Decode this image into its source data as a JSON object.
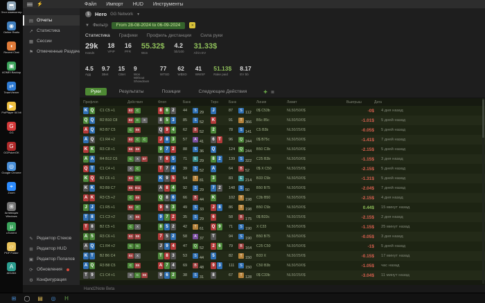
{
  "menubar": {
    "items": [
      "Файл",
      "Импорт",
      "HUD",
      "Инструменты"
    ]
  },
  "sidebar": {
    "top": [
      {
        "label": "Отчеты",
        "glyph": "▤",
        "selected": true
      },
      {
        "label": "Статистика",
        "glyph": "↗"
      },
      {
        "label": "Сессии",
        "glyph": "▦"
      },
      {
        "label": "Отмеченные Раздачи",
        "glyph": "⚑"
      }
    ],
    "bottom": [
      {
        "label": "Редактор Стеков",
        "glyph": "✎"
      },
      {
        "label": "Редактор HUD",
        "glyph": "⊞"
      },
      {
        "label": "Редактор Попапов",
        "glyph": "▣"
      },
      {
        "label": "Обновления",
        "glyph": "⟳",
        "badge": true
      },
      {
        "label": "Конфигурация",
        "glyph": "⚙"
      }
    ]
  },
  "header": {
    "player": "Hero",
    "network": "GG Network",
    "filter_label": "Фильтр",
    "date_range": "From 28-08-2024 to 06-09-2024"
  },
  "view_tabs": [
    {
      "label": "Статистика",
      "active": true
    },
    {
      "label": "Графики"
    },
    {
      "label": "Профиль дистанции"
    },
    {
      "label": "Сила руки"
    }
  ],
  "stats_primary": [
    {
      "value": "29k",
      "label": "Hands",
      "cls": "big"
    },
    {
      "value": "18",
      "label": "VPIP"
    },
    {
      "value": "16",
      "label": "PFR"
    },
    {
      "value": "55.32$",
      "label": "Won",
      "cls": "big green"
    },
    {
      "value": "4.2",
      "label": "bb/100"
    },
    {
      "value": "31.33$",
      "label": "All-in EV",
      "cls": "big green"
    }
  ],
  "stats_secondary": [
    {
      "value": "4.5",
      "label": "Agg"
    },
    {
      "value": "9.7",
      "label": "3Bet"
    },
    {
      "value": "15",
      "label": "CBet"
    },
    {
      "value": "9",
      "label": "Won Without Showdown"
    },
    {
      "value": "77",
      "label": "WTSD"
    },
    {
      "value": "62",
      "label": "W$SD"
    },
    {
      "value": "41",
      "label": "WWSF"
    },
    {
      "value": "51.13$",
      "label": "Rake paid",
      "cls": "green"
    },
    {
      "value": "8.17",
      "label": "EV bb"
    }
  ],
  "table_tabs": [
    {
      "label": "Руки",
      "active": true
    },
    {
      "label": "Результаты"
    },
    {
      "label": "Позиции"
    },
    {
      "label": "Следующие Действия"
    }
  ],
  "hands": {
    "headers": [
      "Префлоп",
      "",
      "Действия",
      "Флоп",
      "Банк",
      "",
      "Терн",
      "Банк",
      "",
      "Линия",
      "Лимит",
      "",
      "Выигрыш",
      "Дата",
      ""
    ],
    "rows": [
      {
        "hole": [
          "Kd",
          "Qc"
        ],
        "pre": "C1 C5 +1",
        "acts": [
          "b:B3",
          "c:C"
        ],
        "flop": [
          "8h",
          "6c",
          "2s"
        ],
        "pot": "44",
        "s1": "S:29",
        "b2": [
          "Jd"
        ],
        "pot2": "87",
        "s2": "S:112",
        "line": "0$ C53b",
        "nl": "NL50/50/0$",
        "profit": "-0$",
        "pc": "neg",
        "date": "4 дня назад"
      },
      {
        "hole": [
          "Qc",
          "Qd"
        ],
        "pre": "R2 B10 C8",
        "acts": [
          "b:B2",
          "c:C",
          "x:X"
        ],
        "flop": [
          "8s",
          "5c",
          "3d"
        ],
        "pot": "85",
        "s1": "S:52",
        "b2": [
          "Kh"
        ],
        "pot2": "91",
        "s2": "T:366",
        "line": "B5c 85c",
        "nl": "NL50/50/0$",
        "profit": "-1.01$",
        "pc": "neg",
        "date": "5 дней назад"
      },
      {
        "hole": [
          "Ah",
          "Qd"
        ],
        "pre": "R3 B7 C5",
        "acts": [
          "c:C",
          "b:B5"
        ],
        "flop": [
          "Qs",
          "9h",
          "4c"
        ],
        "pot": "62",
        "s1": "B:52",
        "b2": [
          "2c"
        ],
        "pot2": "78",
        "s2": "S:141",
        "line": "C5 B3b",
        "nl": "NL50/25/0$",
        "profit": "-0.05$",
        "pc": "neg",
        "date": "5 дней назад"
      },
      {
        "hole": [
          "Ad",
          "Qs"
        ],
        "pre": "C1 R4 +2",
        "acts": [
          "b:B3",
          "c:C",
          "c:C"
        ],
        "flop": [
          "Jh",
          "8d",
          "3c"
        ],
        "pot": "57",
        "s1": "A:41",
        "b2": [
          "6s",
          "Th"
        ],
        "pot2": "96",
        "s2": "Q:244",
        "line": "0$ B75c",
        "nl": "NL50/50/0$",
        "profit": "-1.41$",
        "pc": "neg",
        "date": "7 дней назад"
      },
      {
        "hole": [
          "Kh",
          "Kc"
        ],
        "pre": "R3 C8 +1",
        "acts": [
          "b:B5",
          "b:B9"
        ],
        "flop": [
          "9c",
          "7d",
          "2h"
        ],
        "pot": "88",
        "s1": "S:36",
        "b2": [
          "Qd"
        ],
        "pot2": "124",
        "s2": "Q:244",
        "line": "B50 C3b",
        "nl": "NL50/50/0$",
        "profit": "-2.15$",
        "pc": "neg",
        "date": "5 дней назад"
      },
      {
        "hole": [
          "Ac",
          "Ad"
        ],
        "pre": "R4 B12 C6",
        "acts": [
          "c:C",
          "x:X",
          "b:B7"
        ],
        "flop": [
          "Ts",
          "6h",
          "5d"
        ],
        "pot": "71",
        "s1": "E:29",
        "b2": [
          "8c",
          "2d"
        ],
        "pot2": "139",
        "s2": "S:322",
        "line": "C25 B3b",
        "nl": "NL50/50/0$",
        "profit": "-1.15$",
        "pc": "neg",
        "date": "3 дня назад"
      },
      {
        "hole": [
          "Qh",
          "Td"
        ],
        "pre": "C1 C4 +1",
        "acts": [
          "x:X",
          "c:C"
        ],
        "flop": [
          "Th",
          "7s",
          "4d"
        ],
        "pot": "39",
        "s1": "S:52",
        "b2": [
          "Ad"
        ],
        "pot2": "64",
        "s2": "B:52",
        "line": "0$ X C50",
        "nl": "NL50/25/0$",
        "profit": "-2.15$",
        "pc": "neg",
        "date": "5 дней назад"
      },
      {
        "hole": [
          "Kc",
          "Qh"
        ],
        "pre": "B2 C6 +1",
        "acts": [
          "b:B3",
          "c:C"
        ],
        "flop": [
          "Kd",
          "9s",
          "5h"
        ],
        "pot": "54",
        "s1": "T:81",
        "b2": [
          "3c"
        ],
        "pot2": "83",
        "s2": "E:214",
        "line": "B33 C5b",
        "nl": "NL50/50/0$",
        "profit": "-1.31$",
        "pc": "neg",
        "date": "5 дней назад"
      },
      {
        "hole": [
          "Ks",
          "Kd"
        ],
        "pre": "R3 B9 C7",
        "acts": [
          "b:B5",
          "b:B11"
        ],
        "flop": [
          "As",
          "8h",
          "4c"
        ],
        "pot": "92",
        "s1": "S:29",
        "b2": [
          "7d",
          "2s"
        ],
        "pot2": "148",
        "s2": "S:50",
        "line": "B50 B75",
        "nl": "NL50/50/0$",
        "profit": "-2.04$",
        "pc": "neg",
        "date": "7 дней назад"
      },
      {
        "hole": [
          "Ah",
          "Kh"
        ],
        "pre": "R3 C5 +2",
        "acts": [
          "c:C",
          "b:B6"
        ],
        "flop": [
          "Qc",
          "8s",
          "6d"
        ],
        "pot": "66",
        "s1": "B:44",
        "b2": [
          "Kc"
        ],
        "pot2": "102",
        "s2": "T:198",
        "line": "C3b B50",
        "nl": "NL50/50/0$",
        "profit": "-2.15$",
        "pc": "neg",
        "date": "4 дня назад"
      },
      {
        "hole": [
          "Jc",
          "Jd"
        ],
        "pre": "C1 R5 +1",
        "acts": [
          "b:B4",
          "c:C"
        ],
        "flop": [
          "9h",
          "6s",
          "3c"
        ],
        "pot": "49",
        "s1": "S:33",
        "b2": [
          "Jh",
          "8d"
        ],
        "pot2": "86",
        "s2": "T:198",
        "line": "B50 C5b",
        "nl": "NL50/50/0$",
        "profit": "0.44$",
        "pc": "pos",
        "date": "15 минут назад"
      },
      {
        "hole": [
          "Td",
          "8d"
        ],
        "pre": "C1 C3 +2",
        "acts": [
          "x:X",
          "b:B5"
        ],
        "flop": [
          "9d",
          "7c",
          "2h"
        ],
        "pot": "35",
        "s1": "S:29",
        "b2": [
          "6h"
        ],
        "pot2": "58",
        "s2": "B:175",
        "line": "0$ B33c",
        "nl": "NL50/25/0$",
        "profit": "-2.15$",
        "pc": "neg",
        "date": "2 дня назад"
      },
      {
        "hole": [
          "Th",
          "8s"
        ],
        "pre": "B2 C5 +1",
        "acts": [
          "c:C",
          "x:X"
        ],
        "flop": [
          "8c",
          "5d",
          "2s"
        ],
        "pot": "42",
        "s1": "T:61",
        "b2": [
          "Qh",
          "9c"
        ],
        "pot2": "71",
        "s2": "S:190",
        "line": "X C33",
        "nl": "NL50/50/0$",
        "profit": "-1.15$",
        "pc": "neg",
        "date": "25 минут назад"
      },
      {
        "hole": [
          "Ac",
          "5c"
        ],
        "pre": "R3 C6 +1",
        "acts": [
          "b:B3",
          "b:B8"
        ],
        "flop": [
          "7h",
          "5s",
          "2d"
        ],
        "pot": "58",
        "s1": "A:37",
        "b2": [
          "Ts"
        ],
        "pot2": "94",
        "s2": "S:190",
        "line": "B50 B75",
        "nl": "NL50/50/0$",
        "profit": "-0.05$",
        "pc": "neg",
        "date": "3 дня назад"
      },
      {
        "hole": [
          "As",
          "Qd"
        ],
        "pre": "C1 R4 +2",
        "acts": [
          "c:C",
          "c:C"
        ],
        "flop": [
          "Js",
          "9d",
          "4h"
        ],
        "pot": "47",
        "s1": "Q:52",
        "b2": [
          "2h",
          "6c"
        ],
        "pot2": "79",
        "s2": "B:164",
        "line": "C25 C50",
        "nl": "NL50/50/0$",
        "profit": "-1$",
        "pc": "neg",
        "date": "5 дней назад"
      },
      {
        "hole": [
          "Kd",
          "Td"
        ],
        "pre": "B2 B6 C4",
        "acts": [
          "b:B4",
          "x:X"
        ],
        "flop": [
          "Tc",
          "8h",
          "3s"
        ],
        "pot": "53",
        "s1": "S:44",
        "b2": [
          "5d"
        ],
        "pot2": "82",
        "s2": "T:150",
        "line": "B33 X",
        "nl": "NL50/25/0$",
        "profit": "-0.15$",
        "pc": "neg",
        "date": "17 минут назад"
      },
      {
        "hole": [
          "Ad",
          "Qc"
        ],
        "pre": "R3 B8 C5",
        "acts": [
          "c:C",
          "b:B5"
        ],
        "flop": [
          "Ah",
          "7c",
          "4s"
        ],
        "pot": "69",
        "s1": "B:48",
        "b2": [
          "9h",
          "3d"
        ],
        "pot2": "111",
        "s2": "S:150",
        "line": "C50 B3b",
        "nl": "NL50/50/0$",
        "profit": "-1.05$",
        "pc": "neg",
        "date": "час назад"
      },
      {
        "hole": [
          "Ts",
          "9s"
        ],
        "pre": "C1 C4 +1",
        "acts": [
          "x:X",
          "c:C",
          "b:B6"
        ],
        "flop": [
          "9s",
          "6d",
          "2c"
        ],
        "pot": "38",
        "s1": "S:31",
        "b2": [
          "8s"
        ],
        "pot2": "67",
        "s2": "T:128",
        "line": "0$ C33b",
        "nl": "NL50/25/0$",
        "profit": "-3.04$",
        "pc": "neg",
        "date": "11 минут назад"
      }
    ]
  },
  "statusbar": {
    "text": "Hand2Note Beta"
  },
  "desktop": {
    "icons": [
      {
        "label": "Этот компьютер",
        "name": "computer-icon",
        "color": "#8fa6b8",
        "glyph": "⬒"
      },
      {
        "label": "Online Radio",
        "name": "radio-icon",
        "color": "#3f7fbf",
        "glyph": "◉"
      },
      {
        "label": "Recent Chat",
        "name": "chat-icon",
        "color": "#e07b39",
        "glyph": "◖"
      },
      {
        "label": "AOMEI Backup",
        "name": "aomei-icon",
        "color": "#3ba35a",
        "glyph": "▣"
      },
      {
        "label": "TeamViewer",
        "name": "teamviewer-icon",
        "color": "#2e7bd4",
        "glyph": "⇄"
      },
      {
        "label": "PotPlayer 64 bit",
        "name": "potplayer-icon",
        "color": "#f0c040",
        "glyph": "▶"
      },
      {
        "label": "GG",
        "name": "gg-icon",
        "color": "#d43a3a",
        "glyph": "G"
      },
      {
        "label": "GGPokerOK",
        "name": "ggpokerok-icon",
        "color": "#b02a2a",
        "glyph": "G"
      },
      {
        "label": "Google Chrome",
        "name": "chrome-icon",
        "color": "#4a90d9",
        "glyph": "◎"
      },
      {
        "label": "Zoom",
        "name": "zoom-icon",
        "color": "#2d8cff",
        "glyph": "⌖"
      },
      {
        "label": "Активация Windows",
        "name": "activation-icon",
        "color": "#777777",
        "glyph": "⊞"
      },
      {
        "label": "uTorrent",
        "name": "torrent-icon",
        "color": "#3aa35a",
        "glyph": "µ"
      },
      {
        "label": "PDF Folder",
        "name": "folder-icon",
        "color": "#e8c25a",
        "glyph": "▱"
      },
      {
        "label": "AIDA64",
        "name": "aida64-icon",
        "color": "#2a9d8f",
        "glyph": "A"
      }
    ]
  },
  "taskbar": {
    "icons": [
      {
        "name": "start-button",
        "glyph": "⊞",
        "color": "#4a90d9"
      },
      {
        "name": "search-icon",
        "glyph": "◯",
        "color": "#cccccc"
      },
      {
        "name": "explorer-icon",
        "glyph": "▤",
        "color": "#e8c25a"
      },
      {
        "name": "browser-icon",
        "glyph": "◎",
        "color": "#4a90d9"
      },
      {
        "name": "hand2note-icon",
        "glyph": "H",
        "color": "#6aa84f"
      }
    ]
  }
}
